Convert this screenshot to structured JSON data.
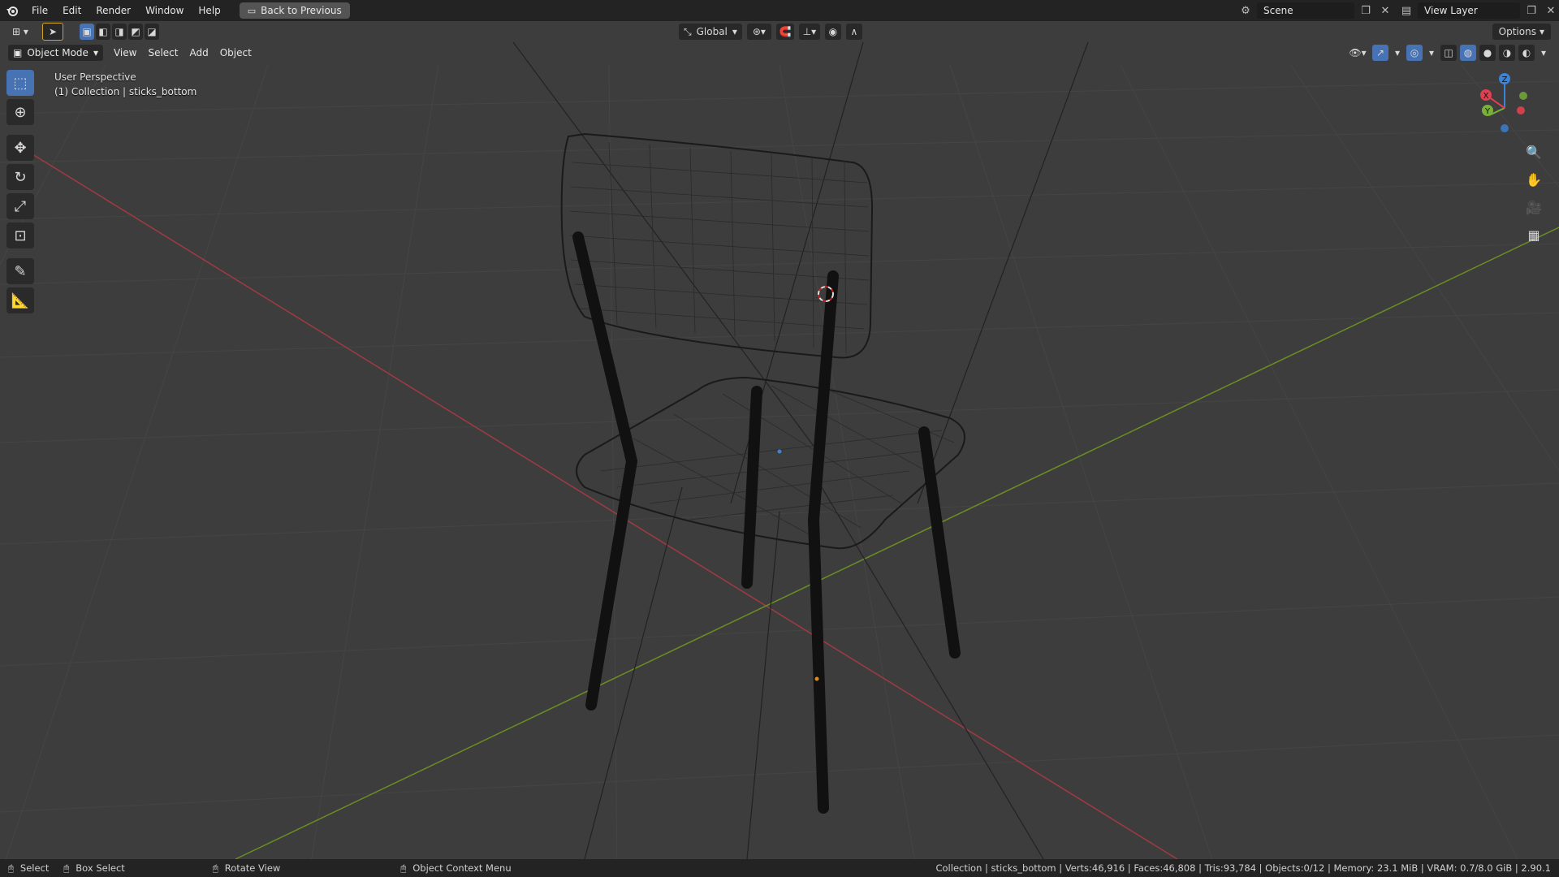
{
  "app": {
    "menus": [
      "File",
      "Edit",
      "Render",
      "Window",
      "Help"
    ],
    "back_button": "Back to Previous"
  },
  "scene": {
    "label": "Scene",
    "view_layer": "View Layer"
  },
  "header": {
    "orientation": "Global",
    "options": "Options"
  },
  "viewport_header": {
    "mode": "Object Mode",
    "menus": [
      "View",
      "Select",
      "Add",
      "Object"
    ]
  },
  "overlay": {
    "perspective": "User Perspective",
    "collection": "(1) Collection | sticks_bottom"
  },
  "toolbar": {
    "tools": [
      "select-box",
      "cursor",
      "move",
      "rotate",
      "scale",
      "transform",
      "annotate",
      "measure"
    ]
  },
  "gizmo": {
    "labels": {
      "x": "X",
      "y": "Y",
      "z": "Z"
    },
    "colors": {
      "x": "#e0404f",
      "y": "#78b038",
      "z": "#3c82d8"
    }
  },
  "statusbar": {
    "select": "Select",
    "box_select": "Box Select",
    "rotate_view": "Rotate View",
    "context_menu": "Object Context Menu",
    "stats": "Collection | sticks_bottom | Verts:46,916 | Faces:46,808 | Tris:93,784 | Objects:0/12 | Memory: 23.1 MiB | VRAM: 0.7/8.0 GiB | 2.90.1"
  },
  "colors": {
    "background": "#3d3d3d",
    "grid": "#4a4a4a",
    "x_axis": "#a13a42",
    "y_axis": "#6b8e23",
    "accent": "#4772b3"
  }
}
